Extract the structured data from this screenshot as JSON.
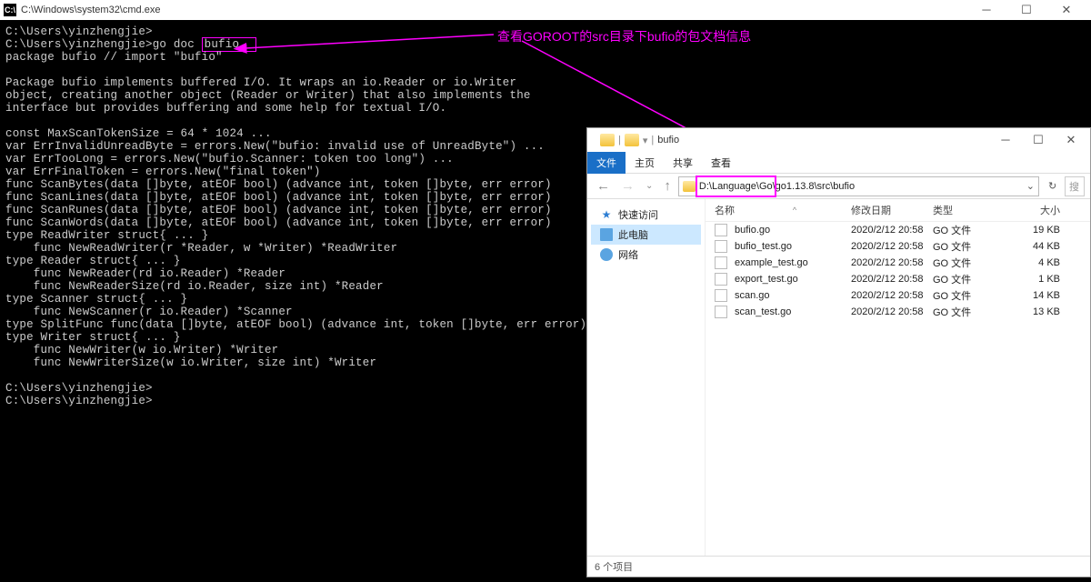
{
  "annotation": "查看GOROOT的src目录下bufio的包文档信息",
  "cmd": {
    "title": "C:\\Windows\\system32\\cmd.exe",
    "prompt1": "C:\\Users\\yinzhengjie>",
    "prompt2": "C:\\Users\\yinzhengjie>go doc ",
    "highlight": "bufio  ",
    "output": "package bufio // import \"bufio\"\n\nPackage bufio implements buffered I/O. It wraps an io.Reader or io.Writer\nobject, creating another object (Reader or Writer) that also implements the\ninterface but provides buffering and some help for textual I/O.\n\nconst MaxScanTokenSize = 64 * 1024 ...\nvar ErrInvalidUnreadByte = errors.New(\"bufio: invalid use of UnreadByte\") ...\nvar ErrTooLong = errors.New(\"bufio.Scanner: token too long\") ...\nvar ErrFinalToken = errors.New(\"final token\")\nfunc ScanBytes(data []byte, atEOF bool) (advance int, token []byte, err error)\nfunc ScanLines(data []byte, atEOF bool) (advance int, token []byte, err error)\nfunc ScanRunes(data []byte, atEOF bool) (advance int, token []byte, err error)\nfunc ScanWords(data []byte, atEOF bool) (advance int, token []byte, err error)\ntype ReadWriter struct{ ... }\n    func NewReadWriter(r *Reader, w *Writer) *ReadWriter\ntype Reader struct{ ... }\n    func NewReader(rd io.Reader) *Reader\n    func NewReaderSize(rd io.Reader, size int) *Reader\ntype Scanner struct{ ... }\n    func NewScanner(r io.Reader) *Scanner\ntype SplitFunc func(data []byte, atEOF bool) (advance int, token []byte, err error)\ntype Writer struct{ ... }\n    func NewWriter(w io.Writer) *Writer\n    func NewWriterSize(w io.Writer, size int) *Writer",
    "prompt3": "C:\\Users\\yinzhengjie>",
    "prompt4": "C:\\Users\\yinzhengjie>"
  },
  "explorer": {
    "title": "bufio",
    "tabs": {
      "file": "文件",
      "home": "主页",
      "share": "共享",
      "view": "查看"
    },
    "address": "D:\\Language\\Go\\go1.13.8\\src\\bufio",
    "sidebar": {
      "quick": "快速访问",
      "pc": "此电脑",
      "network": "网络"
    },
    "headers": {
      "name": "名称",
      "date": "修改日期",
      "type": "类型",
      "size": "大小"
    },
    "files": [
      {
        "name": "bufio.go",
        "date": "2020/2/12 20:58",
        "type": "GO 文件",
        "size": "19 KB"
      },
      {
        "name": "bufio_test.go",
        "date": "2020/2/12 20:58",
        "type": "GO 文件",
        "size": "44 KB"
      },
      {
        "name": "example_test.go",
        "date": "2020/2/12 20:58",
        "type": "GO 文件",
        "size": "4 KB"
      },
      {
        "name": "export_test.go",
        "date": "2020/2/12 20:58",
        "type": "GO 文件",
        "size": "1 KB"
      },
      {
        "name": "scan.go",
        "date": "2020/2/12 20:58",
        "type": "GO 文件",
        "size": "14 KB"
      },
      {
        "name": "scan_test.go",
        "date": "2020/2/12 20:58",
        "type": "GO 文件",
        "size": "13 KB"
      }
    ],
    "status": "6 个项目"
  }
}
